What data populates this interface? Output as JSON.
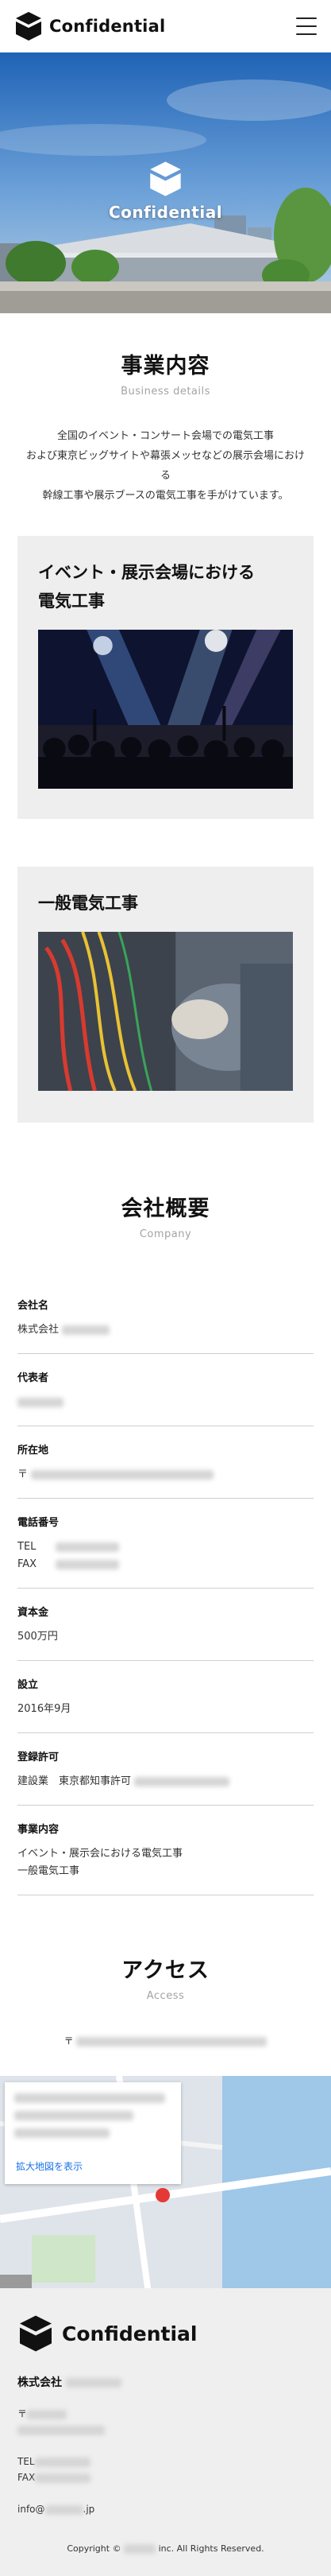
{
  "header": {
    "brand": "Confidential",
    "menu_icon": "hamburger-icon"
  },
  "hero": {
    "logo_text": "Confidential",
    "logo_icon": "stacked-cube-logo"
  },
  "business": {
    "title": "事業内容",
    "subtitle": "Business details",
    "desc_lines": [
      "全国のイベント・コンサート会場での電気工事",
      "および東京ビッグサイトや幕張メッセなどの展示会場におけ",
      "る",
      "幹線工事や展示ブースの電気工事を手がけています。"
    ],
    "cards": [
      {
        "title_lines": [
          "イベント・展示会場における",
          "電気工事"
        ]
      },
      {
        "title_lines": [
          "一般電気工事"
        ]
      }
    ]
  },
  "company": {
    "title": "会社概要",
    "subtitle": "Company",
    "items": [
      {
        "label": "会社名",
        "lines": [
          "株式会社"
        ]
      },
      {
        "label": "代表者",
        "lines": [
          ""
        ]
      },
      {
        "label": "所在地",
        "lines": [
          "〒"
        ]
      },
      {
        "label": "電話番号",
        "lines": [
          "TEL",
          "FAX"
        ]
      },
      {
        "label": "資本金",
        "lines": [
          "500万円"
        ]
      },
      {
        "label": "設立",
        "lines": [
          "2016年9月"
        ]
      },
      {
        "label": "登録許可",
        "lines": [
          "建設業　東京都知事許可"
        ]
      },
      {
        "label": "事業内容",
        "lines": [
          "イベント・展示会における電気工事",
          "一般電気工事"
        ]
      }
    ]
  },
  "access": {
    "title": "アクセス",
    "subtitle": "Access",
    "address_prefix": "〒",
    "map_link": "拡大地図を表示"
  },
  "footer": {
    "brand": "Confidential",
    "company": "株式会社",
    "postal": "〒",
    "tel": "TEL",
    "fax": "FAX",
    "email_prefix": "info@",
    "email_suffix": ".jp",
    "copyright_prefix": "Copyright ©",
    "copyright_suffix": "inc. All Rights Reserved."
  },
  "colors": {
    "card_bg": "#eeeeee",
    "footer_bg": "#efefef",
    "link": "#1a73e8"
  }
}
